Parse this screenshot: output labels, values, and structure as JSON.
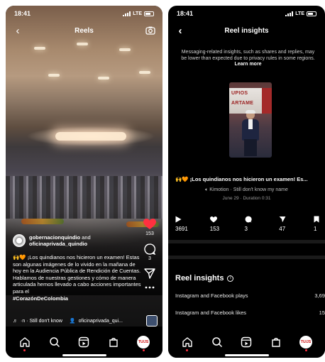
{
  "left": {
    "status": {
      "time": "18:41",
      "network": "LTE"
    },
    "header": {
      "title": "Reels"
    },
    "author": {
      "line1": "gobernacionquindio",
      "and": "and",
      "line2": "oficinaprivada_quindio"
    },
    "actions": {
      "likes": "153",
      "comments": "3"
    },
    "caption": {
      "text": "¡Los quindianos nos hicieron un examen! Estas son algunas imágenes de lo vivido en la mañana de hoy en la Audiencia Pública de Rendición de Cuentas. Hablamos de nuestras gestiones y cómo de manera articulada hemos llevado a cabo acciones importantes para el",
      "hashtag": "#CorazónDeColombia"
    },
    "audio": {
      "track": "·n · Still don't know",
      "tagged": "oficinaprivada_qui..."
    },
    "profile_label": "TU/JS"
  },
  "right": {
    "status": {
      "time": "18:41",
      "network": "LTE"
    },
    "header": {
      "title": "Reel insights"
    },
    "notice": {
      "text": "Messaging-related insights, such as shares and replies, may be lower than expected due to privacy rules in some regions.",
      "link": "Learn more"
    },
    "thumb": {
      "line1": "UPIOS",
      "line2": "ARTAME"
    },
    "caption": "¡Los quindianos nos hicieron un examen! Es...",
    "audio": "Kimotion · Still don't know my name",
    "date": "June 29 · Duration 0:31",
    "metrics": [
      {
        "icon": "play-icon",
        "value": "3691"
      },
      {
        "icon": "heart-icon",
        "value": "153"
      },
      {
        "icon": "comment-icon",
        "value": "3"
      },
      {
        "icon": "share-icon",
        "value": "47"
      },
      {
        "icon": "save-icon",
        "value": "1"
      }
    ],
    "section": {
      "title": "Reel insights"
    },
    "rows": [
      {
        "label": "Instagram and Facebook plays",
        "value": "3,69"
      },
      {
        "label": "Instagram and Facebook likes",
        "value": "15"
      }
    ],
    "profile_label": "TU/JS"
  },
  "colors": {
    "like": "#ff3040",
    "background": "#000000"
  }
}
